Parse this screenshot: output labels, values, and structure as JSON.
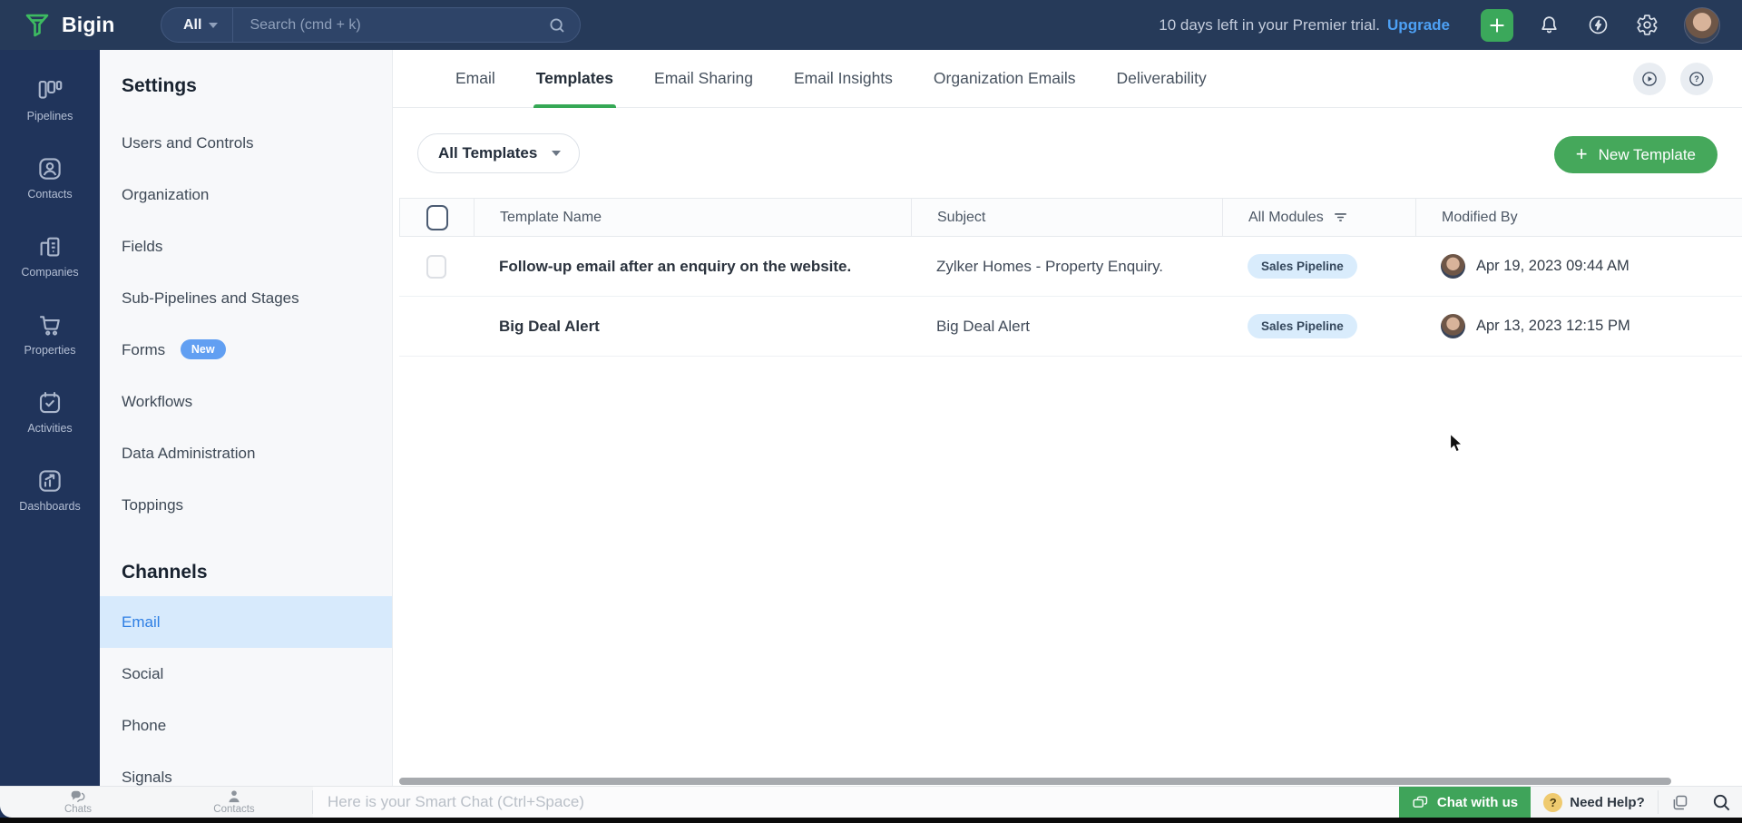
{
  "topbar": {
    "brand": "Bigin",
    "search_scope": "All",
    "search_placeholder": "Search (cmd + k)",
    "trial_text": "10 days left in your Premier trial.",
    "upgrade_label": "Upgrade"
  },
  "nav": {
    "items": [
      "Pipelines",
      "Contacts",
      "Companies",
      "Properties",
      "Activities",
      "Dashboards"
    ]
  },
  "settings": {
    "title": "Settings",
    "items": [
      "Users and Controls",
      "Organization",
      "Fields",
      "Sub-Pipelines and Stages",
      "Forms",
      "Workflows",
      "Data Administration",
      "Toppings"
    ],
    "forms_badge": "New",
    "channels_title": "Channels",
    "channels": [
      "Email",
      "Social",
      "Phone",
      "Signals"
    ],
    "active_channel": "Email"
  },
  "tabs": {
    "items": [
      "Email",
      "Templates",
      "Email Sharing",
      "Email Insights",
      "Organization Emails",
      "Deliverability"
    ],
    "active": "Templates"
  },
  "toolbar": {
    "filter_label": "All Templates",
    "new_template_plus": "+",
    "new_template_label": "New Template"
  },
  "table": {
    "headers": {
      "template_name": "Template Name",
      "subject": "Subject",
      "modules": "All Modules",
      "modified_by": "Modified By"
    },
    "rows": [
      {
        "name": "Follow-up email after an enquiry on the website.",
        "subject": "Zylker Homes - Property Enquiry.",
        "module": "Sales Pipeline",
        "modified": "Apr 19, 2023 09:44 AM"
      },
      {
        "name": "Big Deal Alert",
        "subject": "Big Deal Alert",
        "module": "Sales Pipeline",
        "modified": "Apr 13, 2023 12:15 PM"
      }
    ]
  },
  "bottombar": {
    "chats_label": "Chats",
    "contacts_label": "Contacts",
    "smart_chat_placeholder": "Here is your Smart Chat (Ctrl+Space)",
    "chat_with_us_label": "Chat with us",
    "need_help_label": "Need Help?"
  },
  "colors": {
    "topbar_bg": "#263a59",
    "sidenav_bg": "#20345b",
    "brand_green": "#3ba85b",
    "tab_underline_green": "#35a855",
    "new_template_green": "#45a85b",
    "chat_with_us_green": "#3fa45a",
    "active_channel_bg": "#d7eafc",
    "active_channel_text": "#2e7fe4",
    "module_badge_bg": "#d9ecfc",
    "upgrade_blue": "#4da0f4",
    "new_badge_blue": "#619ff2"
  }
}
